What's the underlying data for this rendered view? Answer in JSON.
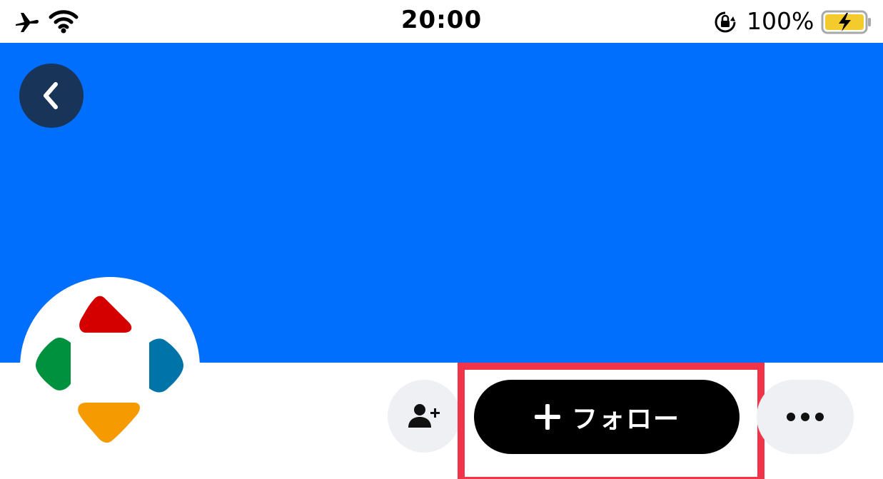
{
  "status_bar": {
    "time": "20:00",
    "battery_percent": "100%",
    "icons": [
      "airplane-icon",
      "wifi-icon",
      "orientation-lock-icon",
      "battery-charging-icon"
    ]
  },
  "header": {
    "cover_color": "#006ffd",
    "back_icon": "chevron-left-icon"
  },
  "profile": {
    "avatar_icon": "dpad-logo-icon",
    "avatar_colors": {
      "top": "#d40000",
      "left": "#00913f",
      "right": "#0074a8",
      "bottom": "#f59a00"
    }
  },
  "actions": {
    "add_friend_icon": "person-add-icon",
    "follow_icon": "plus-icon",
    "follow_label": "フォロー",
    "more_icon": "ellipsis-icon",
    "highlight_color": "#f0354b"
  }
}
